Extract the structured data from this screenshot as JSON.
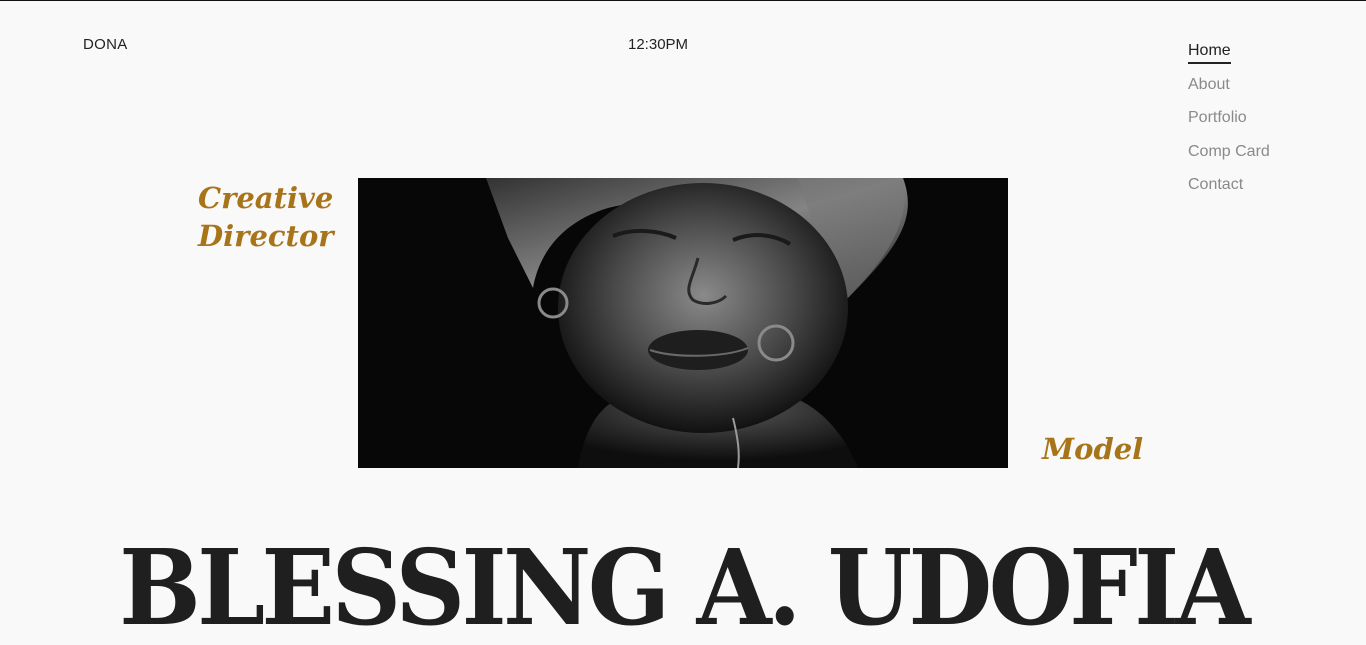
{
  "header": {
    "brand": "DONA",
    "time": "12:30PM"
  },
  "nav": {
    "items": [
      {
        "label": "Home",
        "active": true
      },
      {
        "label": "About",
        "active": false
      },
      {
        "label": "Portfolio",
        "active": false
      },
      {
        "label": "Comp Card",
        "active": false
      },
      {
        "label": "Contact",
        "active": false
      }
    ]
  },
  "hero": {
    "role_left_line1": "Creative",
    "role_left_line2": "Director",
    "role_right": "Model",
    "photo_icon": "portrait-photo",
    "name": "BLESSING A. UDOFIA"
  },
  "colors": {
    "accent": "#a8741a",
    "text": "#222222",
    "muted": "#8a8a8a",
    "background": "#f9f9f9"
  }
}
